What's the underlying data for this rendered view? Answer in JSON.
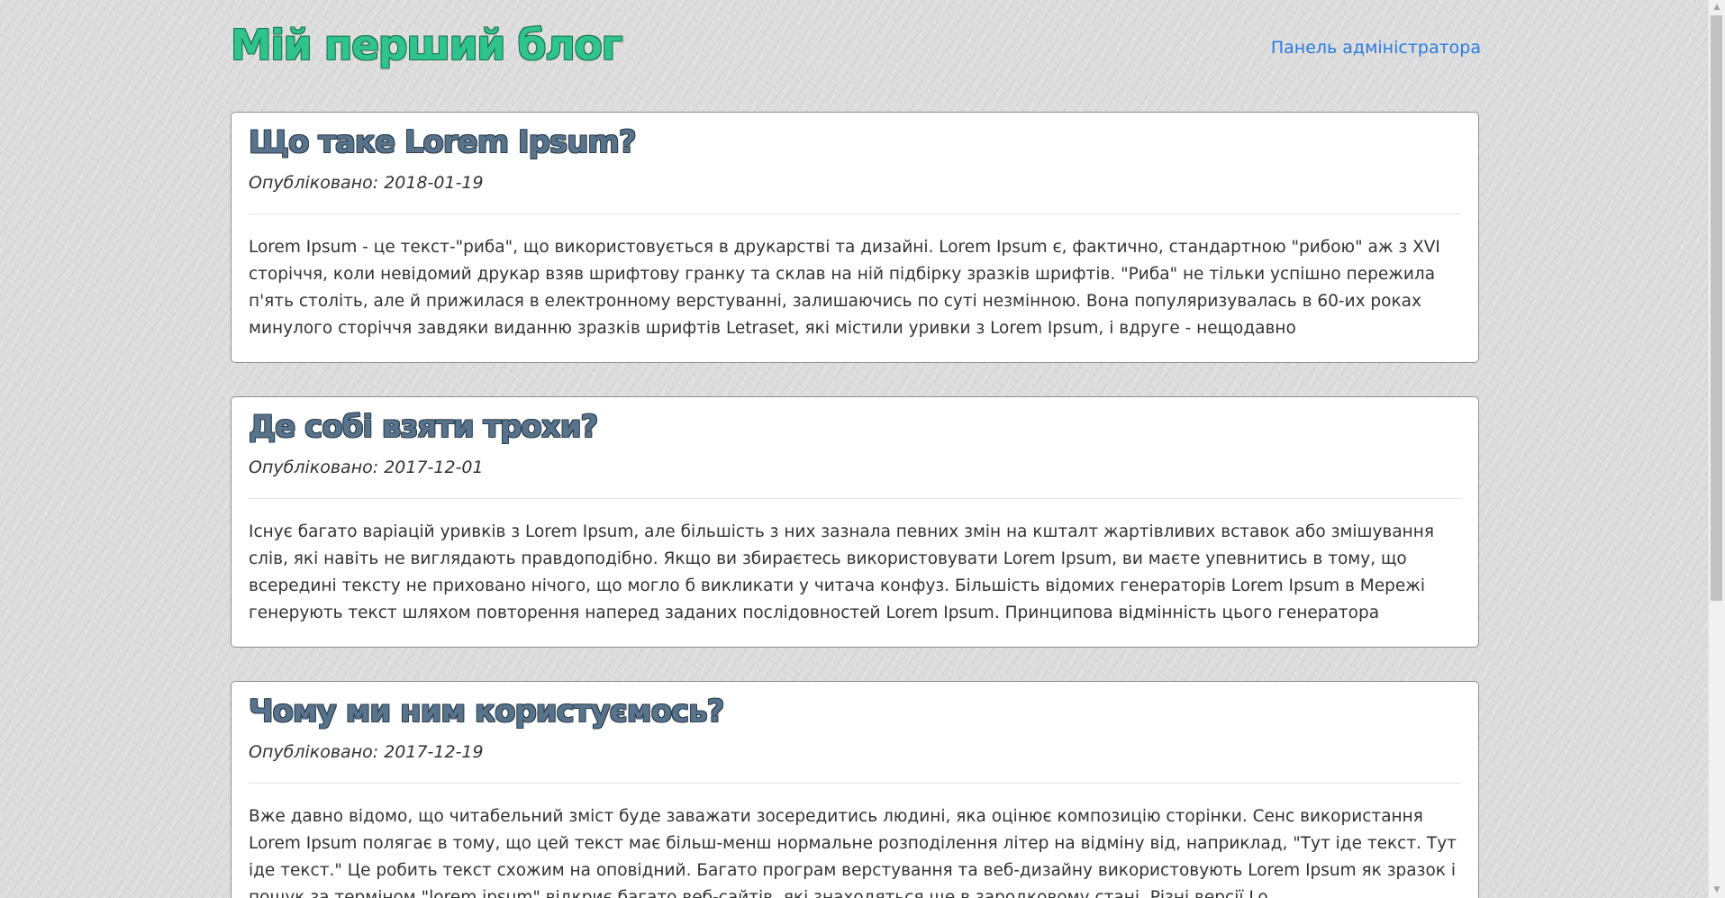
{
  "header": {
    "site_title": "Мій перший блог",
    "admin_link": "Панель адміністратора"
  },
  "posts": [
    {
      "title": "Що таке Lorem Ipsum?",
      "date": "Опубліковано: 2018-01-19",
      "body": "Lorem Ipsum - це текст-\"риба\", що використовується в друкарстві та дизайні. Lorem Ipsum є, фактично, стандартною \"рибою\" аж з XVI сторіччя, коли невідомий друкар взяв шрифтову гранку та склав на ній підбірку зразків шрифтів. \"Риба\" не тільки успішно пережила п'ять століть, але й прижилася в електронному верстуванні, залишаючись по суті незмінною. Вона популяризувалась в 60-их роках минулого сторіччя завдяки виданню зразків шрифтів Letraset, які містили уривки з Lorem Ipsum, і вдруге - нещодавно"
    },
    {
      "title": "Де собі взяти трохи?",
      "date": "Опубліковано: 2017-12-01",
      "body": "Існує багато варіацій уривків з Lorem Ipsum, але більшість з них зазнала певних змін на кшталт жартівливих вставок або змішування слів, які навіть не виглядають правдоподібно. Якщо ви збираєтесь використовувати Lorem Ipsum, ви маєте упевнитись в тому, що всередині тексту не приховано нічого, що могло б викликати у читача конфуз. Більшість відомих генераторів Lorem Ipsum в Мережі генерують текст шляхом повторення наперед заданих послідовностей Lorem Ipsum. Принципова відмінність цього генератора"
    },
    {
      "title": "Чому ми ним користуємось?",
      "date": "Опубліковано: 2017-12-19",
      "body": "Вже давно відомо, що читабельний зміст буде заважати зосередитись людині, яка оцінює композицію сторінки. Сенс використання Lorem Ipsum полягає в тому, що цей текст має більш-менш нормальне розподілення літер на відміну від, наприклад, \"Тут іде текст. Тут іде текст.\" Це робить текст схожим на оповідний. Багато програм верстування та веб-дизайну використовують Lorem Ipsum як зразок і пошук за терміном \"lorem ipsum\" відкриє багато веб-сайтів, які знаходяться ще в зародковому стані. Різні версії Lo"
    }
  ],
  "colors": {
    "site_title": "#2fc48e",
    "post_title": "#58748c",
    "link": "#2a7ae2",
    "background": "#dcdcdc"
  },
  "icons": {
    "scroll_up": "scroll-up-arrow-icon",
    "scroll_down": "scroll-down-arrow-icon"
  }
}
